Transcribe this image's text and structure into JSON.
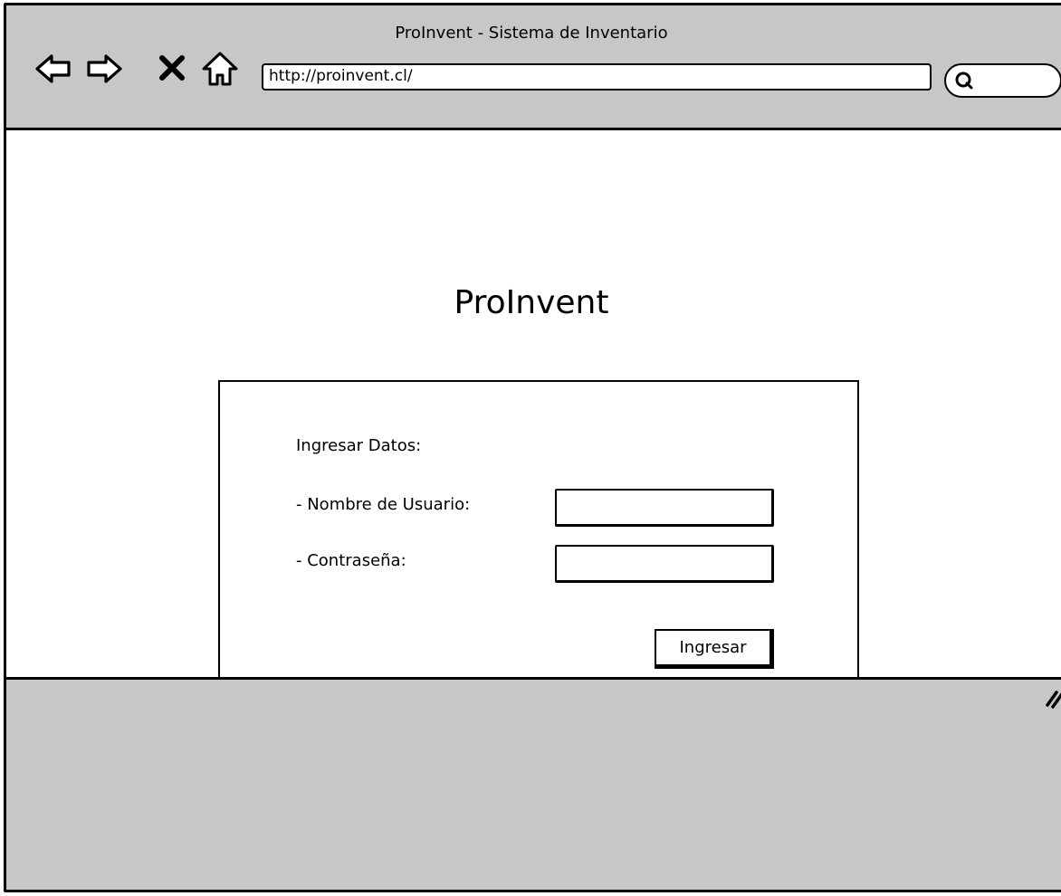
{
  "window": {
    "title": "ProInvent - Sistema de Inventario"
  },
  "toolbar": {
    "back_icon": "back-arrow-icon",
    "forward_icon": "forward-arrow-icon",
    "stop_icon": "close-icon",
    "home_icon": "home-icon",
    "address": "http://proinvent.cl/",
    "search_icon": "search-icon",
    "search_placeholder": ""
  },
  "page": {
    "app_title": "ProInvent",
    "form": {
      "heading": "Ingresar Datos:",
      "username_label": "- Nombre de Usuario:",
      "username_value": "",
      "password_label": "- Contraseña:",
      "password_value": "",
      "submit_label": "Ingresar"
    }
  },
  "status_bar": {
    "resize_icon": "resize-grip-icon"
  },
  "colors": {
    "chrome_bg": "#c7c7c7",
    "content_bg": "#ffffff",
    "stroke": "#000000"
  }
}
